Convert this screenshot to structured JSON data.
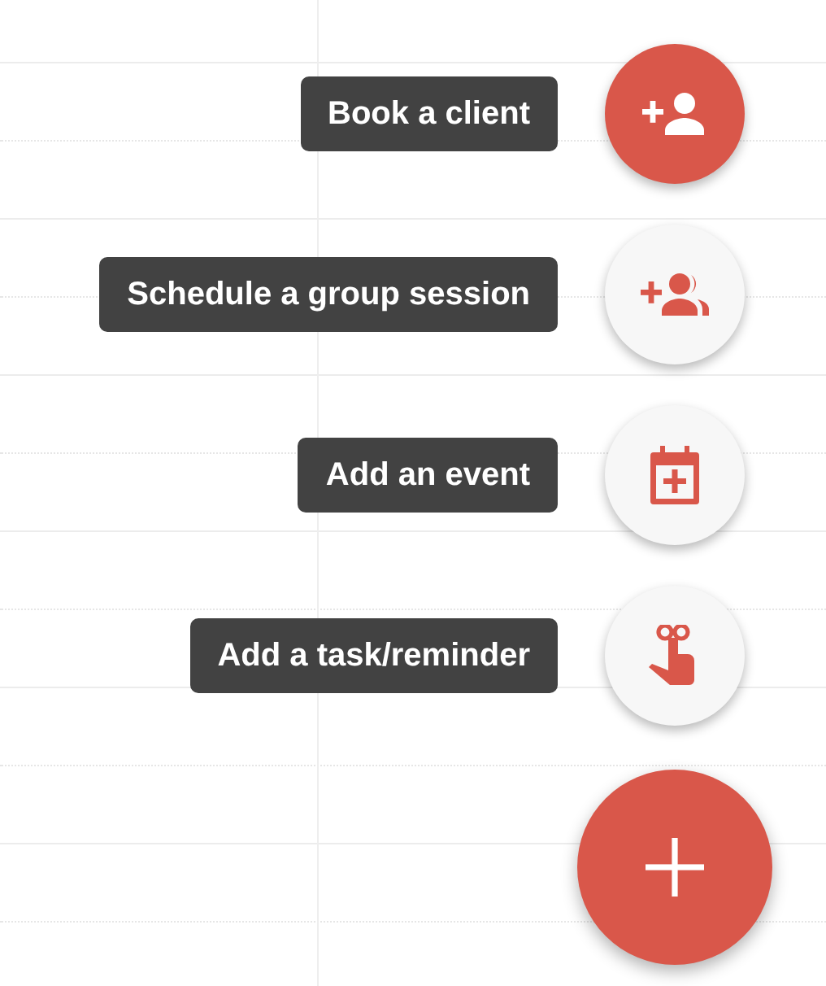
{
  "actions": [
    {
      "label": "Book a client",
      "selected": true
    },
    {
      "label": "Schedule a group session",
      "selected": false
    },
    {
      "label": "Add an event",
      "selected": false
    },
    {
      "label": "Add a task/reminder",
      "selected": false
    }
  ]
}
